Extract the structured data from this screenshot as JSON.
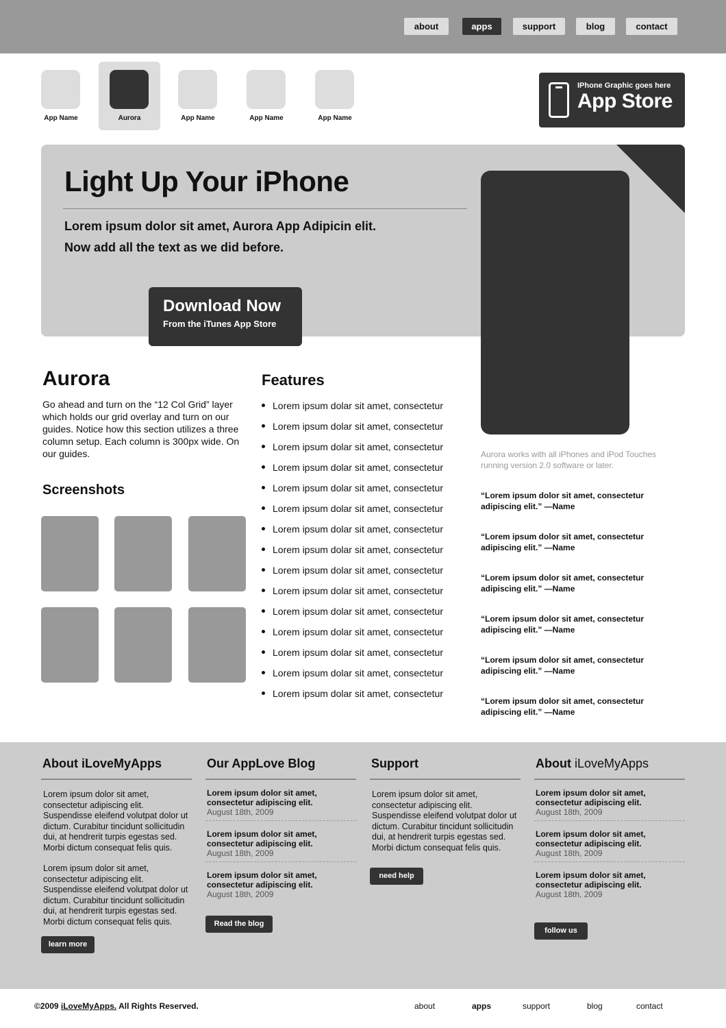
{
  "nav": [
    {
      "label": "about",
      "active": false
    },
    {
      "label": "apps",
      "active": true
    },
    {
      "label": "support",
      "active": false
    },
    {
      "label": "blog",
      "active": false
    },
    {
      "label": "contact",
      "active": false
    }
  ],
  "apps": [
    {
      "label": "App Name",
      "selected": false
    },
    {
      "label": "Aurora",
      "selected": true
    },
    {
      "label": "App Name",
      "selected": false
    },
    {
      "label": "App Name",
      "selected": false
    },
    {
      "label": "App Name",
      "selected": false
    }
  ],
  "appstore": {
    "small": "IPhone Graphic goes here",
    "big": "App Store"
  },
  "hero": {
    "title": "Light Up Your iPhone",
    "line1": "Lorem ipsum dolor sit amet,  Aurora App Adipicin elit.",
    "line2": "Now add all the text as we did before.",
    "download_title": "Download Now",
    "download_sub": "From the iTunes App Store"
  },
  "aurora": {
    "title": "Aurora",
    "text": "Go ahead and turn on the “12 Col Grid” layer which holds our grid overlay and turn on our guides. Notice how this section utilizes a three column setup. Each column is 300px wide. On our guides.",
    "screenshots_title": "Screenshots"
  },
  "features": {
    "title": "Features",
    "items": [
      "Lorem ipsum dolar sit amet, consectetur",
      "Lorem ipsum dolar sit amet, consectetur",
      "Lorem ipsum dolar sit amet, consectetur",
      "Lorem ipsum dolar sit amet, consectetur",
      "Lorem ipsum dolar sit amet, consectetur",
      "Lorem ipsum dolar sit amet, consectetur",
      "Lorem ipsum dolar sit amet, consectetur",
      "Lorem ipsum dolar sit amet, consectetur",
      "Lorem ipsum dolar sit amet, consectetur",
      "Lorem ipsum dolar sit amet, consectetur",
      "Lorem ipsum dolar sit amet, consectetur",
      "Lorem ipsum dolar sit amet, consectetur",
      "Lorem ipsum dolar sit amet, consectetur",
      "Lorem ipsum dolar sit amet, consectetur",
      "Lorem ipsum dolar sit amet, consectetur"
    ]
  },
  "compat_note": "Aurora works with all iPhones and iPod Touches running version 2.0 software or later.",
  "quotes": [
    "“Lorem ipsum dolor sit amet, consectetur adipiscing elit.” —Name",
    "“Lorem ipsum dolor sit amet, consectetur adipiscing elit.” —Name",
    "“Lorem ipsum dolor sit amet, consectetur adipiscing elit.” —Name",
    "“Lorem ipsum dolor sit amet, consectetur adipiscing elit.” —Name",
    "“Lorem ipsum dolor sit amet, consectetur adipiscing elit.” —Name",
    "“Lorem ipsum dolor sit amet, consectetur adipiscing elit.” —Name"
  ],
  "footer": {
    "about": {
      "title": "About iLoveMyApps",
      "p1": "Lorem ipsum dolor sit amet, consectetur adipiscing elit. Suspendisse eleifend volutpat dolor ut dictum. Curabitur tincidunt sollicitudin dui, at hendrerit turpis egestas sed. Morbi dictum consequat felis quis.",
      "p2": "Lorem ipsum dolor sit amet, consectetur adipiscing elit. Suspendisse eleifend volutpat dolor ut dictum. Curabitur tincidunt sollicitudin dui, at hendrerit turpis egestas sed. Morbi dictum consequat felis quis.",
      "button": "learn more"
    },
    "blog": {
      "title": "Our AppLove Blog",
      "posts": [
        {
          "title": "Lorem ipsum dolor sit amet, consectetur adipiscing elit.",
          "date": "August 18th, 2009"
        },
        {
          "title": "Lorem ipsum dolor sit amet, consectetur adipiscing elit.",
          "date": "August 18th, 2009"
        },
        {
          "title": "Lorem ipsum dolor sit amet, consectetur adipiscing elit.",
          "date": "August 18th, 2009"
        }
      ],
      "button": "Read the blog"
    },
    "support": {
      "title": "Support",
      "text": "Lorem ipsum dolor sit amet, consectetur adipiscing elit. Suspendisse eleifend volutpat dolor ut dictum. Curabitur tincidunt sollicitudin dui, at hendrerit turpis egestas sed. Morbi dictum consequat felis quis.",
      "button": "need help"
    },
    "about2": {
      "title_bold": "About",
      "title_light": " iLoveMyApps",
      "posts": [
        {
          "title": "Lorem ipsum dolor sit amet, consectetur adipiscing elit.",
          "date": "August 18th, 2009"
        },
        {
          "title": "Lorem ipsum dolor sit amet, consectetur adipiscing elit.",
          "date": "August 18th, 2009"
        },
        {
          "title": "Lorem ipsum dolor sit amet, consectetur adipiscing elit.",
          "date": "August 18th, 2009"
        }
      ],
      "button": "follow us"
    }
  },
  "bottom": {
    "copyright_prefix": "©2009 ",
    "copyright_brand": "iLoveMyApps.",
    "copyright_suffix": " All Rights Reserved.",
    "nav": [
      {
        "label": "about",
        "active": false
      },
      {
        "label": "apps",
        "active": true
      },
      {
        "label": "support",
        "active": false
      },
      {
        "label": "blog",
        "active": false
      },
      {
        "label": "contact",
        "active": false
      }
    ]
  },
  "colors": {
    "dark": "#333333",
    "mid": "#999999",
    "light": "#cccccc",
    "tile": "#dddddd"
  },
  "icons": [
    "iphone-icon"
  ]
}
